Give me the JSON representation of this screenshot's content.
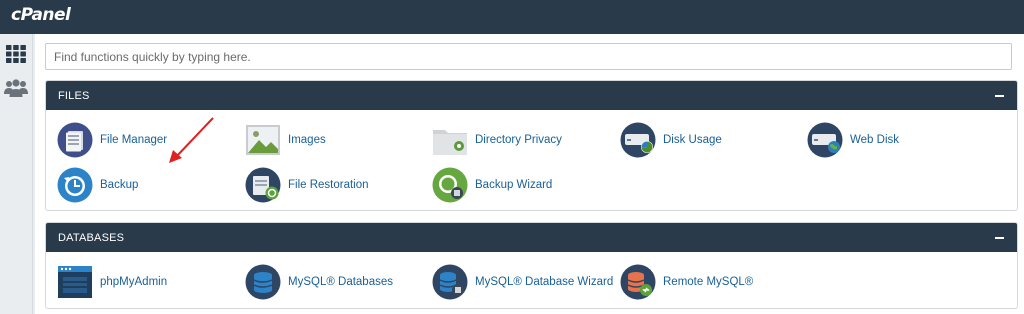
{
  "app": {
    "logo": "cPanel"
  },
  "leftnav": [
    {
      "name": "tools",
      "icon": "grid-icon"
    },
    {
      "name": "users",
      "icon": "users-icon"
    }
  ],
  "search": {
    "placeholder": "Find functions quickly by typing here."
  },
  "files": {
    "title": "FILES",
    "items": [
      {
        "label": "File Manager",
        "icon": "file-manager-icon"
      },
      {
        "label": "Images",
        "icon": "images-icon"
      },
      {
        "label": "Directory Privacy",
        "icon": "directory-privacy-icon"
      },
      {
        "label": "Disk Usage",
        "icon": "disk-usage-icon"
      },
      {
        "label": "Web Disk",
        "icon": "web-disk-icon"
      },
      {
        "label": "Backup",
        "icon": "backup-icon"
      },
      {
        "label": "File Restoration",
        "icon": "file-restoration-icon"
      },
      {
        "label": "Backup Wizard",
        "icon": "backup-wizard-icon"
      }
    ]
  },
  "databases": {
    "title": "DATABASES",
    "items": [
      {
        "label": "phpMyAdmin",
        "icon": "phpmyadmin-icon"
      },
      {
        "label": "MySQL® Databases",
        "icon": "mysql-databases-icon"
      },
      {
        "label": "MySQL® Database Wizard",
        "icon": "mysql-database-wizard-icon"
      },
      {
        "label": "Remote MySQL®",
        "icon": "remote-mysql-icon"
      }
    ]
  },
  "colors": {
    "header": "#293a4a",
    "link": "#195f97",
    "annotation_arrow": "#e02020"
  }
}
